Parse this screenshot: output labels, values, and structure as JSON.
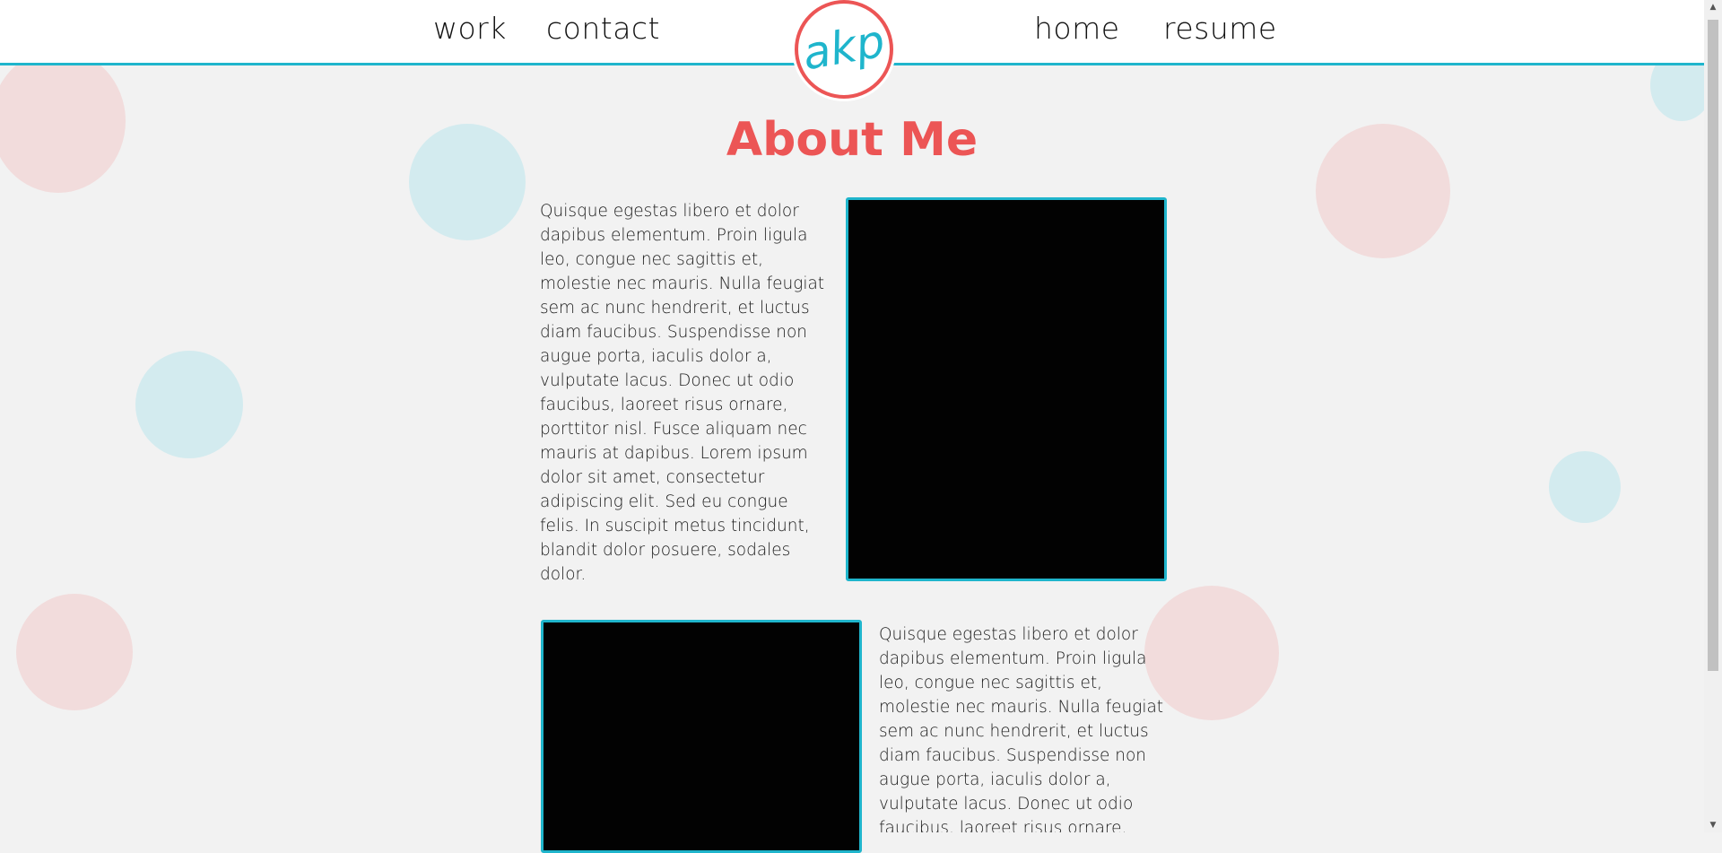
{
  "nav": {
    "work": "work",
    "contact": "contact",
    "home": "home",
    "resume": "resume"
  },
  "logo": {
    "text": "akp"
  },
  "main": {
    "title": "About Me",
    "paragraph_1": "Quisque egestas libero et dolor dapibus elementum. Proin ligula leo, congue nec sagittis et, molestie nec mauris. Nulla feugiat sem ac nunc hendrerit, et luctus diam faucibus. Suspendisse non augue porta, iaculis dolor a, vulputate lacus. Donec ut odio faucibus, laoreet risus ornare, porttitor nisl. Fusce aliquam nec mauris at dapibus. Lorem ipsum dolor sit amet, consectetur adipiscing elit. Sed eu congue felis. In suscipit metus tincidunt, blandit dolor posuere, sodales dolor.",
    "paragraph_2": "Quisque egestas libero et dolor dapibus elementum. Proin ligula leo, congue nec sagittis et, molestie nec mauris. Nulla feugiat sem ac nunc hendrerit, et luctus diam faucibus. Suspendisse non augue porta, iaculis dolor a, vulputate lacus. Donec ut odio faucibus, laoreet risus ornare,"
  },
  "colors": {
    "accent_red": "#ec5555",
    "accent_cyan": "#1fb5cc",
    "bubble_pink": "#f2dcdc",
    "bubble_blue": "#d3ebef",
    "background": "#f2f2f2"
  },
  "icons": {
    "scroll_up": "scroll-up-arrow-icon",
    "scroll_down": "scroll-down-arrow-icon"
  }
}
